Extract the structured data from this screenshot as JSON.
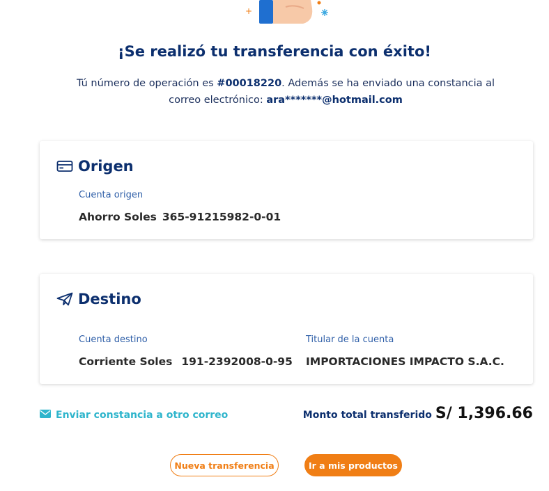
{
  "header": {
    "title": "¡Se realizó tu transferencia con éxito!",
    "subtitle_prefix": "Tú número de operación es ",
    "operation_number": "#00018220",
    "subtitle_middle": ". Además se ha enviado una constancia al correo electrónico: ",
    "email": "ara*******@hotmail.com"
  },
  "origen": {
    "title": "Origen",
    "icon": "credit-card-icon",
    "account_label": "Cuenta origen",
    "account_type": "Ahorro Soles",
    "account_number": "365-91215982-0-01"
  },
  "destino": {
    "title": "Destino",
    "icon": "paper-plane-icon",
    "account_label": "Cuenta destino",
    "account_type": "Corriente Soles",
    "account_number": "191-2392008-0-95",
    "holder_label": "Titular de la cuenta",
    "holder_name": "IMPORTACIONES IMPACTO S.A.C."
  },
  "actions": {
    "send_receipt": "Enviar constancia a otro correo",
    "total_label": "Monto total transferido",
    "total_amount": "S/ 1,396.66",
    "new_transfer": "Nueva transferencia",
    "go_products": "Ir a mis productos"
  },
  "colors": {
    "primary": "#0c2f6e",
    "accent_orange": "#f07e15",
    "link_teal": "#2fb5cc",
    "label_blue": "#2f5fa8"
  }
}
